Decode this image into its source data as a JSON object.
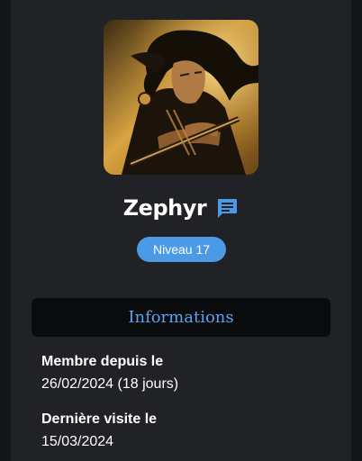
{
  "profile": {
    "username": "Zephyr",
    "avatar_alt": "avatar",
    "level_badge": "Niveau 17",
    "chat_icon": "chat-message-icon"
  },
  "informations": {
    "title": "Informations",
    "items": [
      {
        "label": "Membre depuis le",
        "value": "26/02/2024 (18 jours)"
      },
      {
        "label": "Dernière visite le",
        "value": "15/03/2024"
      }
    ]
  },
  "colors": {
    "page_bg": "#151619",
    "panel_bg": "#202226",
    "accent": "#4b9ae6",
    "header_text": "#5aa3f0"
  }
}
